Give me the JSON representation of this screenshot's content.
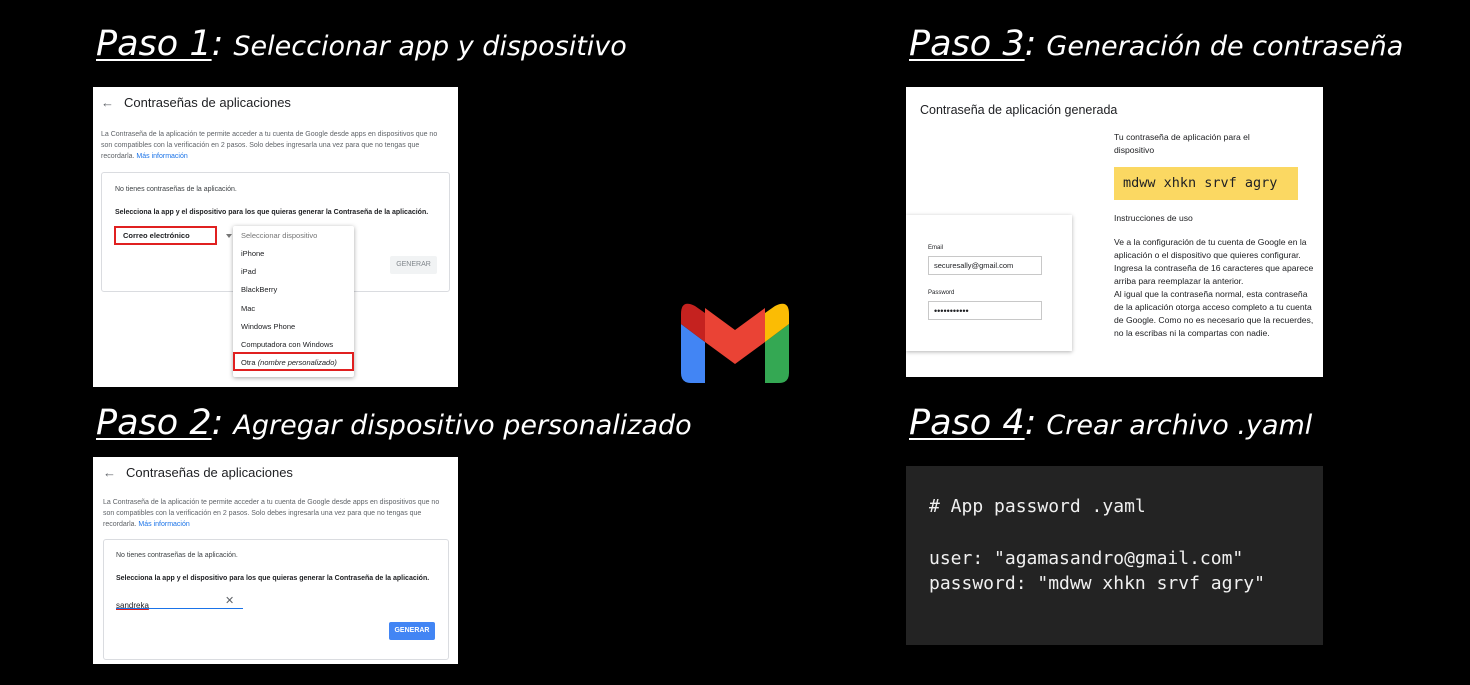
{
  "steps": {
    "s1": {
      "num": "Paso 1",
      "desc": "Seleccionar app y dispositivo"
    },
    "s2": {
      "num": "Paso 2",
      "desc": "Agregar dispositivo personalizado"
    },
    "s3": {
      "num": "Paso 3",
      "desc": "Generación de contraseña"
    },
    "s4": {
      "num": "Paso 4",
      "desc": "Crear archivo .yaml"
    }
  },
  "app_passwords": {
    "title": "Contraseñas de aplicaciones",
    "intro": "La Contraseña de la aplicación te permite acceder a tu cuenta de Google desde apps en dispositivos que no son compatibles con la verificación en 2 pasos. Solo debes ingresarla una vez para que no tengas que recordarla.",
    "more_info": "Más información",
    "none_text": "No tienes contraseñas de la aplicación.",
    "select_prompt": "Selecciona la app y el dispositivo para los que quieras generar la Contraseña de la aplicación.",
    "app_selected": "Correo electrónico",
    "generate": "GENERAR"
  },
  "device_dropdown": {
    "header": "Seleccionar dispositivo",
    "items": [
      "iPhone",
      "iPad",
      "BlackBerry",
      "Mac",
      "Windows Phone",
      "Computadora con Windows"
    ],
    "other": "Otra",
    "other_hint": "(nombre personalizado)"
  },
  "custom_device": {
    "value": "sandreka",
    "clear_icon": "close-icon"
  },
  "generated": {
    "title": "Contraseña de aplicación generada",
    "heading": "Tu contraseña de aplicación para el dispositivo",
    "password": "mdww xhkn srvf agry",
    "instructions_title": "Instrucciones de uso",
    "instructions_1": "Ve a la configuración de tu cuenta de Google en la aplicación o el dispositivo que quieres configurar. Ingresa la contraseña de 16 caracteres que aparece arriba para reemplazar la anterior.",
    "instructions_2": "Al igual que la contraseña normal, esta contraseña de la aplicación otorga acceso completo a tu cuenta de Google. Como no es necesario que la recuerdes, no la escribas ni la compartas con nadie.",
    "email_label": "Email",
    "email_value": "securesally@gmail.com",
    "password_label": "Password",
    "password_dots": "•••••••••••"
  },
  "yaml": {
    "comment": "# App password .yaml",
    "user_line": "user: \"agamasandro@gmail.com\"",
    "password_line": "password: \"mdww xhkn srvf agry\""
  },
  "colors": {
    "gmail_red": "#ea4335",
    "gmail_dark_red": "#c5221f",
    "gmail_blue": "#4285f4",
    "gmail_green": "#34a853",
    "gmail_yellow": "#fbbc04",
    "highlight_red": "#e02020",
    "password_yellow": "#fbd862"
  }
}
